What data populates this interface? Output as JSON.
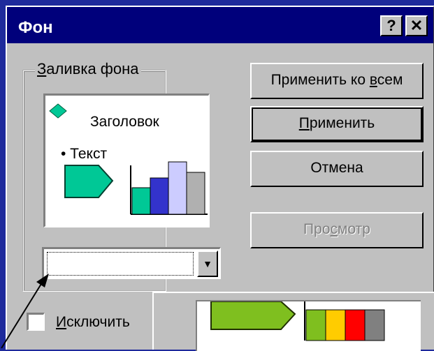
{
  "dialog": {
    "title": "Фон",
    "help_button": "?",
    "close_button": "✕"
  },
  "fill_group": {
    "label_prefix": "",
    "label_hotkey": "З",
    "label_rest": "аливка фона"
  },
  "preview": {
    "title": "Заголовок",
    "text": "• Текст",
    "bar_colors": [
      "#00c896",
      "#3333cc",
      "#ccccff",
      "#b0b0b0"
    ]
  },
  "buttons": {
    "apply_all_prefix": "Применить ко ",
    "apply_all_hotkey": "в",
    "apply_all_rest": "сем",
    "apply_hotkey": "П",
    "apply_rest": "рименить",
    "cancel": "Отмена",
    "preview_prefix": "Про",
    "preview_hotkey": "с",
    "preview_rest": "мотр"
  },
  "fill_combo": {
    "value": ""
  },
  "exclude_checkbox": {
    "hotkey": "И",
    "label_rest": "сключить ",
    "checked": false
  },
  "overlay_colors": [
    "#7fbf1f",
    "#ffcc00",
    "#ff0000",
    "#808080"
  ]
}
